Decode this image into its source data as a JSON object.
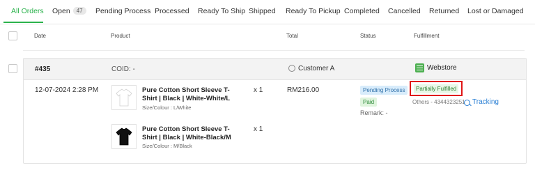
{
  "tabs": {
    "all_orders": "All Orders",
    "open": "Open",
    "open_count": "47",
    "pending_process": "Pending Process",
    "processed": "Processed",
    "ready_to_ship": "Ready To Ship",
    "shipped": "Shipped",
    "ready_to_pickup": "Ready To Pickup",
    "completed": "Completed",
    "cancelled": "Cancelled",
    "returned": "Returned",
    "lost_or_damaged": "Lost or Damaged"
  },
  "table": {
    "headers": {
      "date": "Date",
      "product": "Product",
      "total": "Total",
      "status": "Status",
      "fulfillment": "Fulfillment"
    }
  },
  "order": {
    "id": "#435",
    "coid": "COID: -",
    "customer": "Customer A",
    "channel": "Webstore",
    "date": "12-07-2024 2:28 PM",
    "total": "RM216.00",
    "status_pending": "Pending Process",
    "status_paid": "Paid",
    "remark": "Remark: -",
    "fulfillment_status": "Partially Fulfilled",
    "fulfillment_courier": "Others - 4344323251",
    "tracking_label": "Tracking",
    "items": [
      {
        "name": "Pure Cotton Short Sleeve T-Shirt | Black | White-White/L",
        "variant": "Size/Colour : L/White",
        "qty": "x 1",
        "shirt_color": "#ffffff"
      },
      {
        "name": "Pure Cotton Short Sleeve T-Shirt | Black | White-Black/M",
        "variant": "Size/Colour : M/Black",
        "qty": "x 1",
        "shirt_color": "#111111"
      }
    ]
  },
  "colors": {
    "accent": "#2bb24c",
    "highlight_border": "#e01515",
    "link": "#2a7fd4"
  }
}
